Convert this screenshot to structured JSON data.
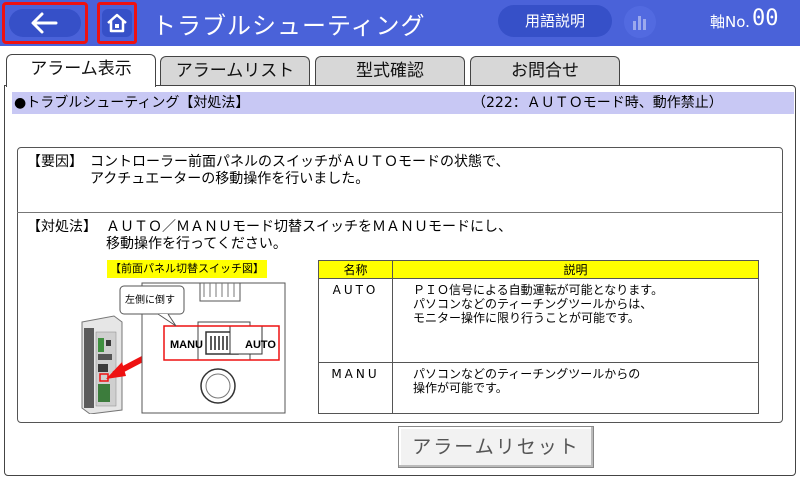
{
  "header": {
    "title": "トラブルシューティング",
    "glossary_label": "用語説明",
    "axis_label": "軸No.",
    "axis_value": "00"
  },
  "tabs": [
    {
      "label": "アラーム表示",
      "active": true
    },
    {
      "label": "アラームリスト",
      "active": false
    },
    {
      "label": "型式確認",
      "active": false
    },
    {
      "label": "お問合せ",
      "active": false
    }
  ],
  "info_bar": {
    "title": "●トラブルシューティング【対処法】",
    "code": "（222：ＡＵＴＯモード時、動作禁止）"
  },
  "cause": {
    "label": "【要因】",
    "line1": "コントローラー前面パネルのスイッチがＡＵＴＯモードの状態で、",
    "line2": "アクチュエーターの移動操作を行いました。"
  },
  "remedy": {
    "label": "【対処法】",
    "line1": "ＡＵＴＯ／ＭＡＮＵモード切替スイッチをＭＡＮＵモードにし、",
    "line2": "移動操作を行ってください。"
  },
  "diagram": {
    "title": "【前面パネル切替スイッチ図】",
    "callout": "左側に倒す",
    "left_label": "MANU",
    "right_label": "AUTO"
  },
  "mode_table": {
    "headers": [
      "名称",
      "説明"
    ],
    "rows": [
      {
        "name": "AUTO",
        "lines": [
          "ＰＩＯ信号による自動運転が可能となります。",
          "パソコンなどのティーチングツールからは、",
          "モニター操作に限り行うことが可能です。"
        ]
      },
      {
        "name": "MANU",
        "lines": [
          "パソコンなどのティーチングツールからの",
          "操作が可能です。"
        ]
      }
    ]
  },
  "reset_button": {
    "label": "アラームリセット"
  },
  "colors": {
    "header_bg": "#4a62d9",
    "highlight": "#ffff00",
    "info_bar": "#c8c8f4",
    "outline_red": "#e11111"
  }
}
